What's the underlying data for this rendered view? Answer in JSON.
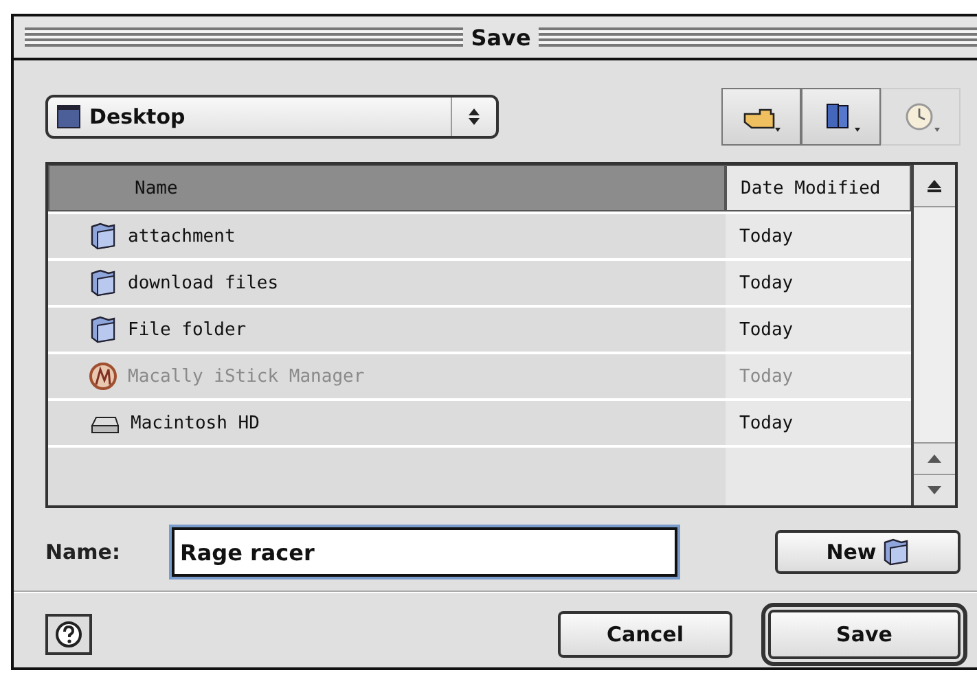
{
  "window": {
    "title": "Save"
  },
  "location": {
    "value": "Desktop"
  },
  "toolbar": [
    {
      "kind": "shortcuts"
    },
    {
      "kind": "favorites"
    },
    {
      "kind": "recent"
    }
  ],
  "table": {
    "columns": [
      {
        "label": "Name",
        "selected": true
      },
      {
        "label": "Date Modified",
        "selected": false
      }
    ],
    "rows": [
      {
        "kind": "folder",
        "name": "attachment",
        "date": "Today",
        "disabled": false
      },
      {
        "kind": "folder",
        "name": "download files",
        "date": "Today",
        "disabled": false
      },
      {
        "kind": "folder",
        "name": "File folder",
        "date": "Today",
        "disabled": false
      },
      {
        "kind": "app",
        "name": "Macally iStick Manager",
        "date": "Today",
        "disabled": true
      },
      {
        "kind": "disk",
        "name": "Macintosh HD",
        "date": "Today",
        "disabled": false
      }
    ]
  },
  "name_field": {
    "label": "Name:",
    "value": "Rage racer"
  },
  "new_button": {
    "label": "New"
  },
  "buttons": [
    {
      "label": "Cancel",
      "default": false
    },
    {
      "label": "Save",
      "default": true
    }
  ]
}
